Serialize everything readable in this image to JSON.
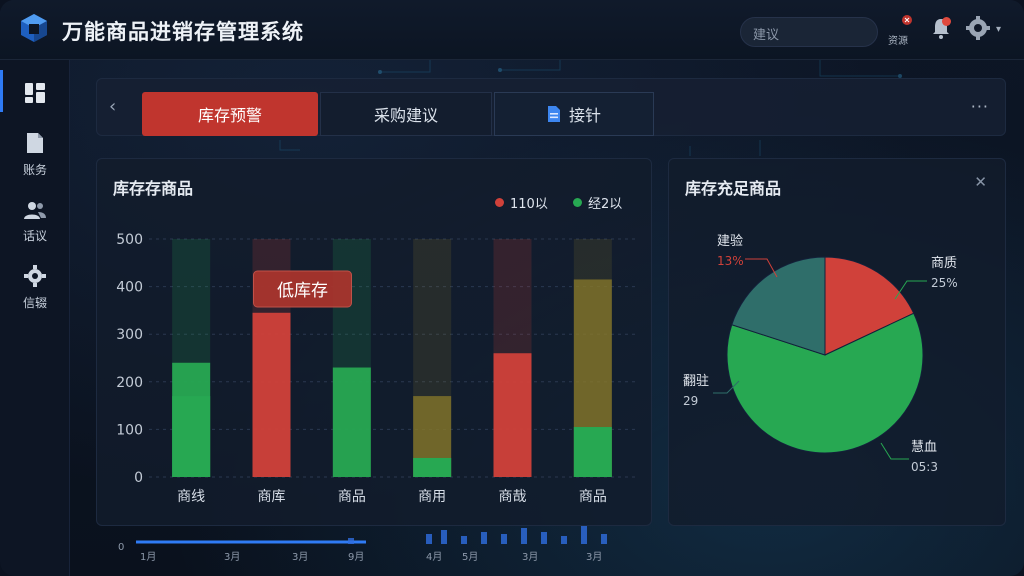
{
  "app": {
    "title": "万能商品进销存管理系统"
  },
  "header": {
    "search_placeholder": "建议",
    "resource_caption": "资源"
  },
  "sidebar": {
    "items": [
      {
        "label": "",
        "icon": "dashboard-icon"
      },
      {
        "label": "账务",
        "icon": "document-icon"
      },
      {
        "label": "话议",
        "icon": "users-icon"
      },
      {
        "label": "信辍",
        "icon": "gear-icon"
      }
    ]
  },
  "tabs": [
    {
      "label": "库存预警",
      "active": true
    },
    {
      "label": "采购建议",
      "active": false
    },
    {
      "label": "接针",
      "active": false
    }
  ],
  "stock_panel": {
    "title": "库存存商品",
    "tooltip": "低库存"
  },
  "pie_panel": {
    "title": "库存充足商品"
  },
  "mini_axis": {
    "y0": "0",
    "x_labels": [
      "1月",
      "3月",
      "3月",
      "9月",
      "4月",
      "5月",
      "3月",
      "3月"
    ]
  },
  "colors": {
    "red": "#d0413a",
    "green": "#27a852",
    "olive": "#8a7a2a",
    "teal": "#2f6e6a",
    "accent": "#2f7bf5"
  },
  "chart_data": [
    {
      "type": "bar",
      "title": "库存存商品",
      "legend_position": "top-right",
      "series_names": [
        "110以",
        "经2以"
      ],
      "categories": [
        "商线",
        "商库",
        "商品",
        "商用",
        "商哉",
        "商品"
      ],
      "ylim": [
        0,
        500
      ],
      "yticks": [
        "0",
        "100",
        "200",
        "300",
        "400",
        "500"
      ],
      "values": [
        240,
        345,
        230,
        170,
        260,
        415
      ],
      "highlight": [
        170,
        0,
        0,
        40,
        0,
        105
      ],
      "bar_colors": [
        "green",
        "red",
        "green",
        "olive",
        "red",
        "olive"
      ],
      "highlight_colors": [
        "green",
        "green",
        "green",
        "green",
        "red",
        "green"
      ],
      "background_max": [
        500,
        500,
        500,
        500,
        500,
        500
      ]
    },
    {
      "type": "pie",
      "title": "库存充足商品",
      "slices": [
        {
          "label": "建验",
          "value_label": "13%",
          "value": 18,
          "color": "red"
        },
        {
          "label": "商质",
          "value_label": "25%",
          "value": 62,
          "color": "green"
        },
        {
          "label": "翻驻",
          "value_label": "29",
          "value": 20,
          "color": "teal"
        },
        {
          "label": "慧血",
          "value_label": "05:3",
          "value": 0,
          "color": "green"
        }
      ]
    }
  ]
}
